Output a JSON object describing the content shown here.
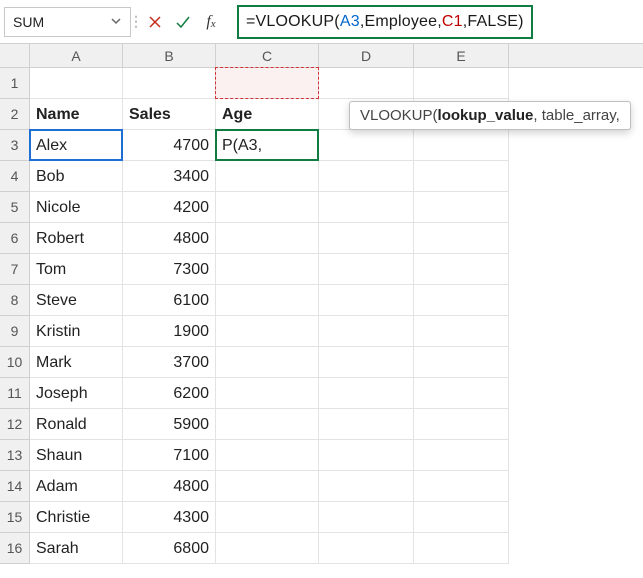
{
  "formula_bar": {
    "name_box": "SUM",
    "formula_tokens": [
      {
        "t": "=VLOOKUP(",
        "c": "black"
      },
      {
        "t": "A3",
        "c": "blue"
      },
      {
        "t": ",Employee,",
        "c": "black"
      },
      {
        "t": "C1",
        "c": "red"
      },
      {
        "t": ",FALSE)",
        "c": "black"
      }
    ]
  },
  "tooltip": {
    "fn": "VLOOKUP(",
    "bold_arg": "lookup_value",
    "rest": ", table_array, "
  },
  "columns": [
    "A",
    "B",
    "C",
    "D",
    "E"
  ],
  "column_widths": [
    "wA",
    "wB",
    "wC",
    "wD",
    "wE"
  ],
  "headers": {
    "A": "Name",
    "B": "Sales",
    "C": "Age"
  },
  "c3_display": "P(A3,",
  "rows": [
    {
      "n": 1
    },
    {
      "n": 2,
      "name": "Name",
      "sales": "Sales",
      "age": "Age",
      "header": true
    },
    {
      "n": 3,
      "name": "Alex",
      "sales": "4700"
    },
    {
      "n": 4,
      "name": "Bob",
      "sales": "3400"
    },
    {
      "n": 5,
      "name": "Nicole",
      "sales": "4200"
    },
    {
      "n": 6,
      "name": "Robert",
      "sales": "4800"
    },
    {
      "n": 7,
      "name": "Tom",
      "sales": "7300"
    },
    {
      "n": 8,
      "name": "Steve",
      "sales": "6100"
    },
    {
      "n": 9,
      "name": "Kristin",
      "sales": "1900"
    },
    {
      "n": 10,
      "name": "Mark",
      "sales": "3700"
    },
    {
      "n": 11,
      "name": "Joseph",
      "sales": "6200"
    },
    {
      "n": 12,
      "name": "Ronald",
      "sales": "5900"
    },
    {
      "n": 13,
      "name": "Shaun",
      "sales": "7100"
    },
    {
      "n": 14,
      "name": "Adam",
      "sales": "4800"
    },
    {
      "n": 15,
      "name": "Christie",
      "sales": "4300"
    },
    {
      "n": 16,
      "name": "Sarah",
      "sales": "6800"
    }
  ],
  "chart_data": {
    "type": "table",
    "columns": [
      "Name",
      "Sales",
      "Age"
    ],
    "data": [
      [
        "Alex",
        4700,
        null
      ],
      [
        "Bob",
        3400,
        null
      ],
      [
        "Nicole",
        4200,
        null
      ],
      [
        "Robert",
        4800,
        null
      ],
      [
        "Tom",
        7300,
        null
      ],
      [
        "Steve",
        6100,
        null
      ],
      [
        "Kristin",
        1900,
        null
      ],
      [
        "Mark",
        3700,
        null
      ],
      [
        "Joseph",
        6200,
        null
      ],
      [
        "Ronald",
        5900,
        null
      ],
      [
        "Shaun",
        7100,
        null
      ],
      [
        "Adam",
        4800,
        null
      ],
      [
        "Christie",
        4300,
        null
      ],
      [
        "Sarah",
        6800,
        null
      ]
    ]
  }
}
